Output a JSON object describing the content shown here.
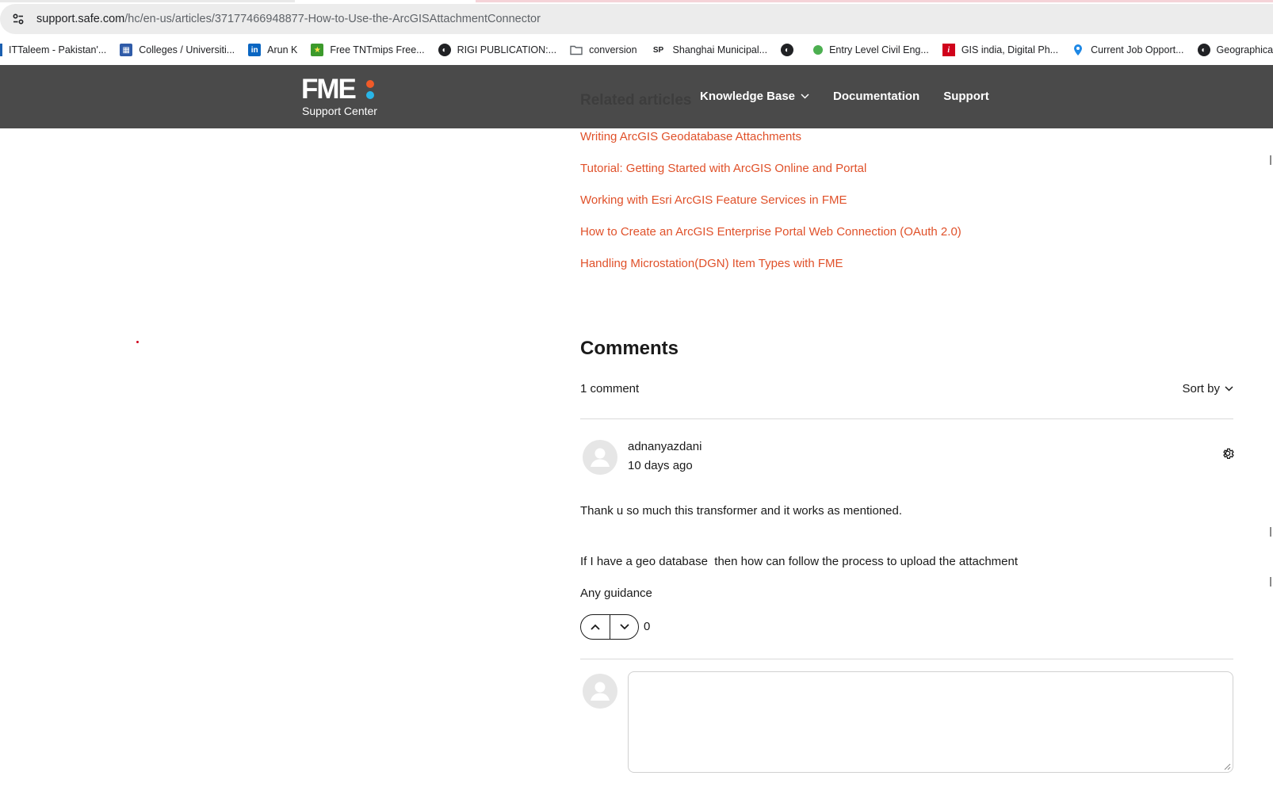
{
  "browser": {
    "url_host": "support.safe.com",
    "url_path": "/hc/en-us/articles/37177466948877-How-to-Use-the-ArcGISAttachmentConnector",
    "bookmarks": [
      {
        "label": "ITTaleem - Pakistan'...",
        "icon": "line-bar-icon"
      },
      {
        "label": "Colleges / Universiti...",
        "icon": "calendar-icon"
      },
      {
        "label": "Arun K",
        "icon": "linkedin-icon"
      },
      {
        "label": "Free TNTmips Free...",
        "icon": "star-icon"
      },
      {
        "label": "RIGI PUBLICATION:...",
        "icon": "globe-icon"
      },
      {
        "label": "conversion",
        "icon": "folder-icon"
      },
      {
        "label": "Shanghai Municipal...",
        "icon": "sp-logo-icon"
      },
      {
        "label": "",
        "icon": "globe-icon"
      },
      {
        "label": "Entry Level Civil Eng...",
        "icon": "green-dot-icon"
      },
      {
        "label": "GIS india, Digital Ph...",
        "icon": "info-red-icon"
      },
      {
        "label": "Current Job Opport...",
        "icon": "map-pin-icon"
      },
      {
        "label": "Geographical Infor...",
        "icon": "globe-icon"
      }
    ]
  },
  "header": {
    "logo_text": "FME",
    "logo_subtitle": "Support Center",
    "ghost_heading": "Related articles",
    "nav": {
      "knowledge_base": "Knowledge Base",
      "documentation": "Documentation",
      "support": "Support"
    }
  },
  "related_articles": [
    "Writing ArcGIS Geodatabase Attachments",
    "Tutorial: Getting Started with ArcGIS Online and Portal",
    "Working with Esri ArcGIS Feature Services in FME",
    "How to Create an ArcGIS Enterprise Portal Web Connection (OAuth 2.0)",
    "Handling Microstation(DGN) Item Types with FME"
  ],
  "comments": {
    "title": "Comments",
    "count_label": "1 comment",
    "sort_label": "Sort by",
    "items": [
      {
        "author": "adnanyazdani",
        "time_ago": "10 days ago",
        "lines": [
          "Thank u so much this transformer and it works as mentioned.",
          "If I have a geo database  then how can follow the process to upload the attachment",
          "Any guidance"
        ],
        "votes": "0"
      }
    ],
    "reply_placeholder": ""
  },
  "colors": {
    "header_bg": "#4a4a4a",
    "link": "#e0512a",
    "logo_red": "#f05a28",
    "logo_blue": "#29b6e8"
  }
}
